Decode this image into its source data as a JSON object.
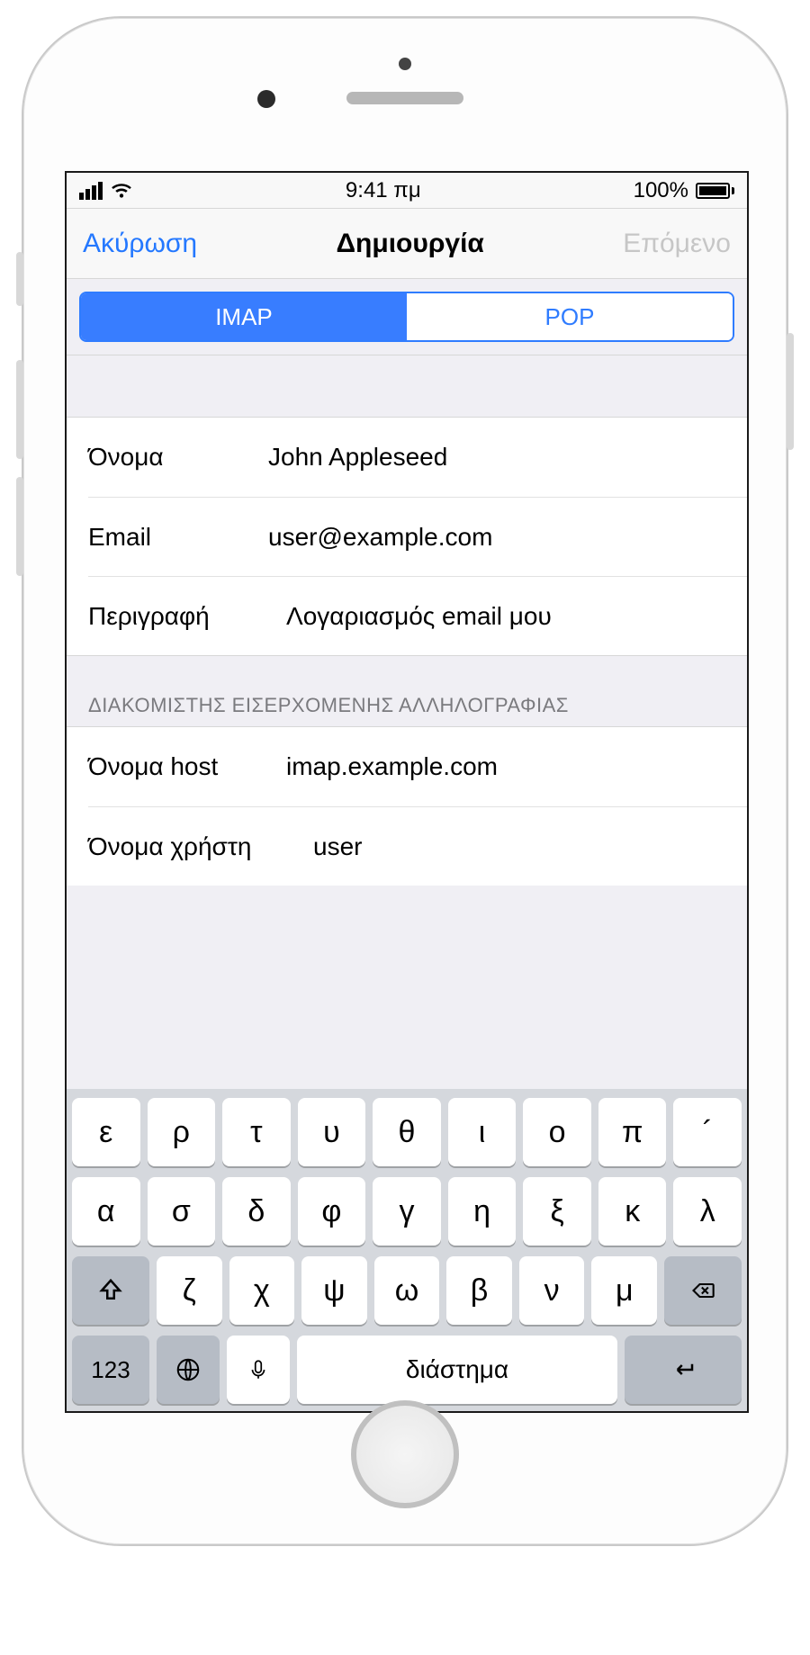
{
  "status": {
    "time": "9:41 πμ",
    "battery": "100%"
  },
  "nav": {
    "cancel": "Ακύρωση",
    "title": "Δημιουργία",
    "next": "Επόμενο"
  },
  "segmented": {
    "imap": "IMAP",
    "pop": "POP"
  },
  "account": {
    "name_label": "Όνομα",
    "name_value": "John Appleseed",
    "email_label": "Email",
    "email_value": "user@example.com",
    "desc_label": "Περιγραφή",
    "desc_value": "Λογαριασμός email μου"
  },
  "incoming": {
    "header": "ΔΙΑΚΟΜΙΣΤΗΣ ΕΙΣΕΡΧΟΜΕΝΗΣ ΑΛΛΗΛΟΓΡΑΦΙΑΣ",
    "host_label": "Όνομα host",
    "host_value": "imap.example.com",
    "user_label": "Όνομα χρήστη",
    "user_value": "user"
  },
  "keyboard": {
    "row1": [
      "ε",
      "ρ",
      "τ",
      "υ",
      "θ",
      "ι",
      "ο",
      "π",
      "´"
    ],
    "row2": [
      "α",
      "σ",
      "δ",
      "φ",
      "γ",
      "η",
      "ξ",
      "κ",
      "λ"
    ],
    "row3": [
      "ζ",
      "χ",
      "ψ",
      "ω",
      "β",
      "ν",
      "μ"
    ],
    "numbers": "123",
    "space": "διάστημα"
  }
}
